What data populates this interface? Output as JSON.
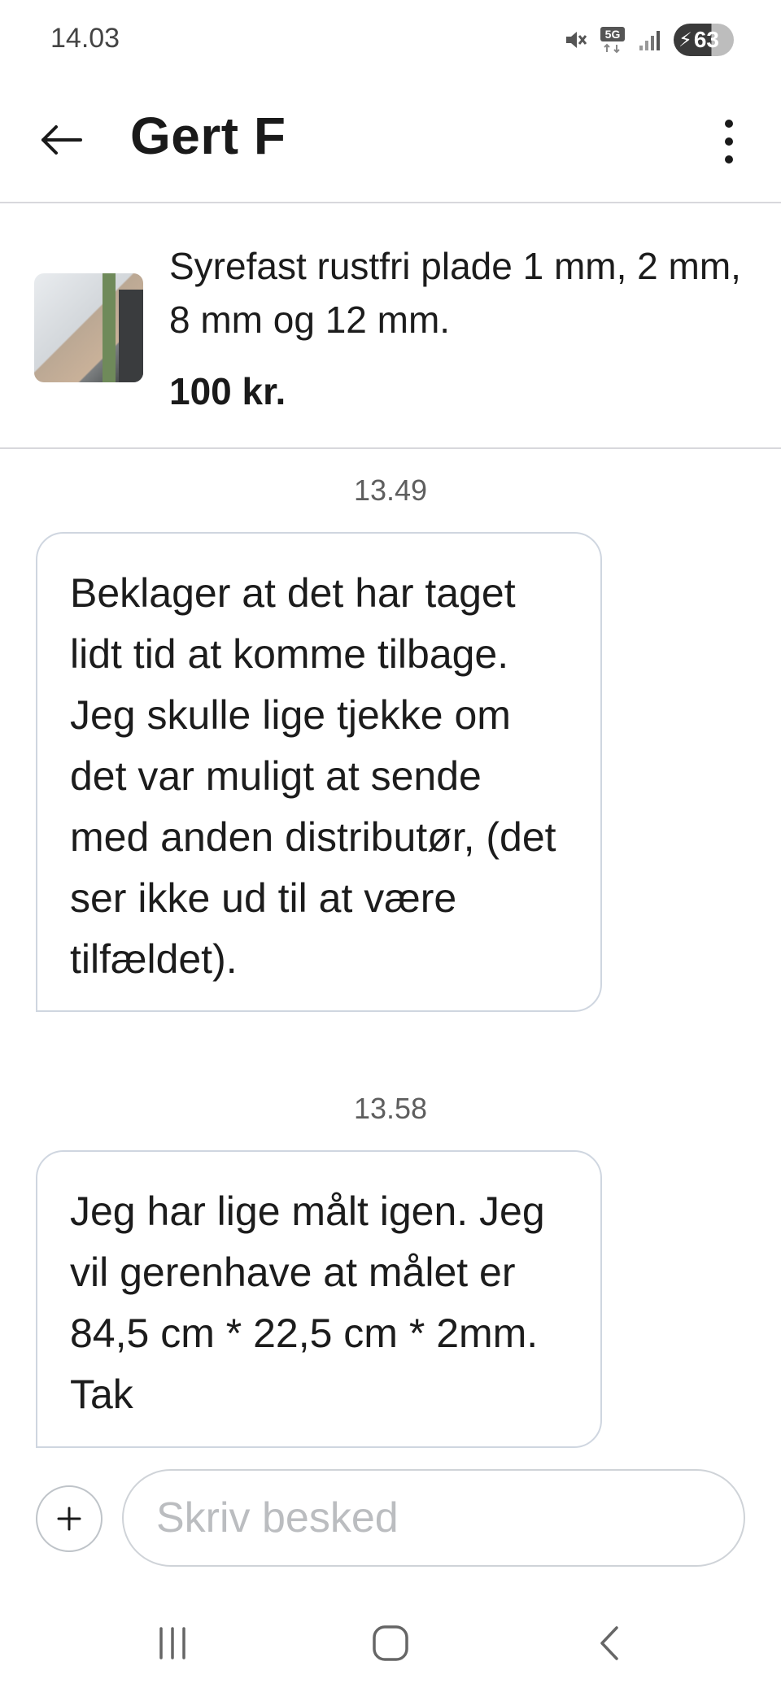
{
  "status_bar": {
    "time": "14.03",
    "network": "5G",
    "battery": "63"
  },
  "header": {
    "contact_name": "Gert F"
  },
  "listing": {
    "title": "Syrefast rustfri plade 1 mm, 2 mm, 8 mm og 12 mm.",
    "price": "100 kr."
  },
  "messages": [
    {
      "time": "13.49",
      "text": "Beklager at det har taget lidt tid at komme tilbage. Jeg skulle lige tjekke om det var muligt at sende med anden distributør, (det ser ikke ud til at være tilfældet)."
    },
    {
      "time": "13.58",
      "text": "Jeg har lige målt igen. Jeg vil gerenhave at målet er 84,5 cm * 22,5 cm * 2mm. Tak"
    }
  ],
  "composer": {
    "placeholder": "Skriv besked"
  }
}
